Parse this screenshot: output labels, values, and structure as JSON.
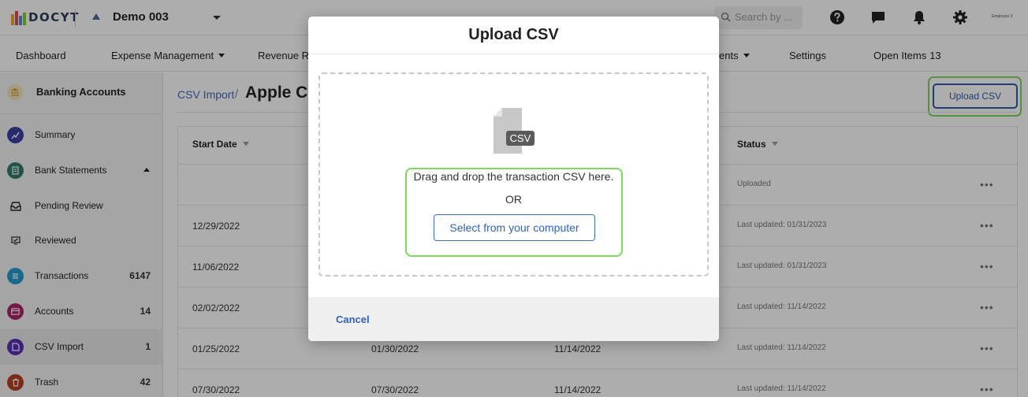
{
  "colors": {
    "brand_dark": "#2d3b5e",
    "link_blue": "#3b6fc1",
    "button_blue": "#2d5ba6",
    "highlight_green": "#7ed957"
  },
  "header": {
    "logo_text": "DOCYT",
    "business_name": "Demo 003",
    "search_placeholder": "Search by ...",
    "icons": [
      "help-icon",
      "chat-icon",
      "bell-icon",
      "gear-icon"
    ],
    "user_label": "Employee 3"
  },
  "nav": {
    "dashboard": "Dashboard",
    "expense": "Expense Management",
    "revenue": "Revenue Re",
    "reports": "ents",
    "settings": "Settings",
    "open_items": "Open Items",
    "open_items_count": "13"
  },
  "sidebar": {
    "title": "Banking Accounts",
    "items": [
      {
        "label": "Summary",
        "count": "",
        "icon": "summary-icon",
        "color": "#3c3fa8"
      },
      {
        "label": "Bank Statements",
        "count": "",
        "icon": "bank-statements-icon",
        "color": "#2e7d6b"
      },
      {
        "label": "Pending Review",
        "count": "",
        "icon": "inbox-icon",
        "color": ""
      },
      {
        "label": "Reviewed",
        "count": "",
        "icon": "reviewed-icon",
        "color": ""
      },
      {
        "label": "Transactions",
        "count": "6147",
        "icon": "transactions-icon",
        "color": "#1f9ed1"
      },
      {
        "label": "Accounts",
        "count": "14",
        "icon": "accounts-icon",
        "color": "#b0246a"
      },
      {
        "label": "CSV Import",
        "count": "1",
        "icon": "csv-import-icon",
        "color": "#5a2fb8"
      },
      {
        "label": "Trash",
        "count": "42",
        "icon": "trash-icon",
        "color": "#b8401f"
      }
    ]
  },
  "main": {
    "breadcrumb": "CSV Import",
    "separator": "/",
    "title": "Apple Ca",
    "upload_button": "Upload CSV",
    "columns": {
      "start_date": "Start Date",
      "status": "Status"
    },
    "rows": [
      {
        "start": "",
        "end": "",
        "uploaded": "",
        "status": "Uploaded"
      },
      {
        "start": "12/29/2022",
        "end": "",
        "uploaded": "",
        "status": "Last updated: 01/31/2023"
      },
      {
        "start": "11/06/2022",
        "end": "",
        "uploaded": "",
        "status": "Last updated: 01/31/2023"
      },
      {
        "start": "02/02/2022",
        "end": "",
        "uploaded": "",
        "status": "Last updated: 11/14/2022"
      },
      {
        "start": "01/25/2022",
        "end": "01/30/2022",
        "uploaded": "11/14/2022",
        "status": "Last updated: 11/14/2022"
      },
      {
        "start": "07/30/2022",
        "end": "07/30/2022",
        "uploaded": "11/14/2022",
        "status": "Last updated: 11/14/2022"
      }
    ],
    "row_menu": "•••"
  },
  "modal": {
    "title": "Upload CSV",
    "file_badge": "CSV",
    "drop_text": "Drag and drop the transaction CSV here.",
    "or_text": "OR",
    "select_button": "Select from your computer",
    "cancel": "Cancel"
  }
}
